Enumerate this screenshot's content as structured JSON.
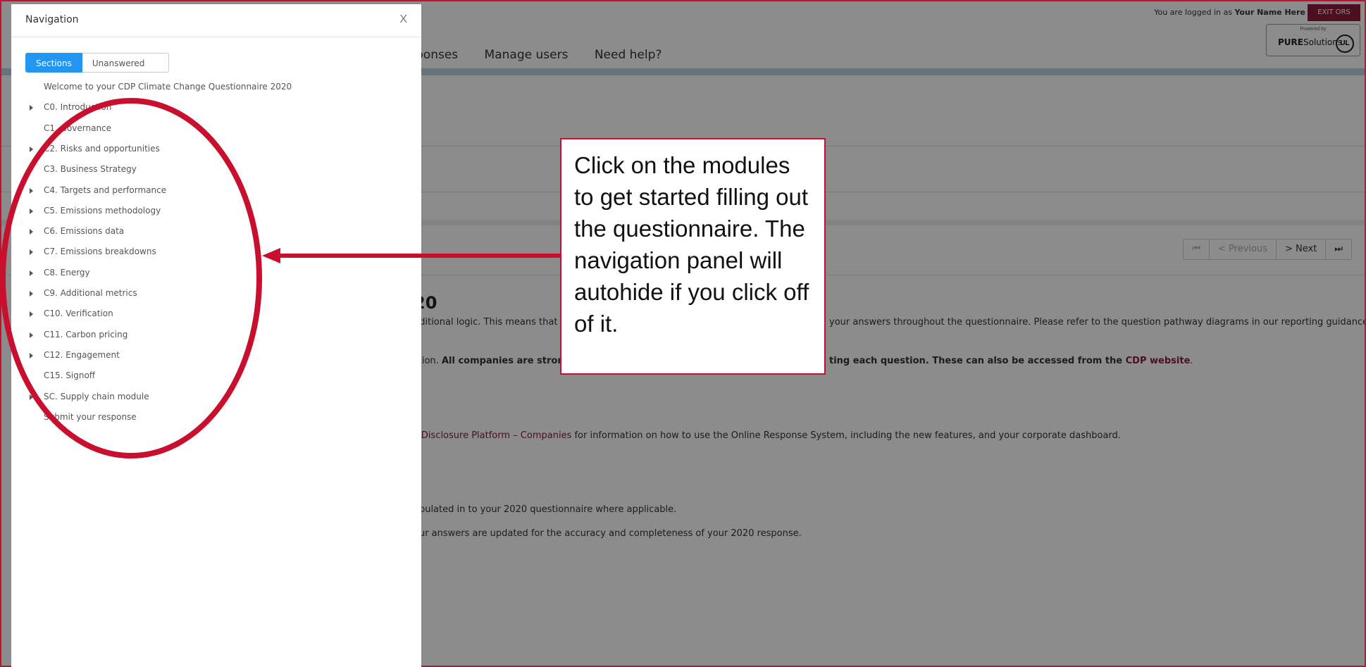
{
  "header": {
    "login_prefix": "You are logged in as ",
    "user_name": "Your Name Here",
    "exit_label": "EXIT ORS",
    "powered_by": "Powered by",
    "pure_bold": "PURE",
    "pure_rest": "Solutions",
    "ul_logo": "UL",
    "nav_items": [
      "ponses",
      "Manage users",
      "Need help?"
    ]
  },
  "pager": {
    "first_icon": "skip-first-icon",
    "prev_label": "< Previous",
    "next_label": "> Next",
    "last_icon": "skip-last-icon"
  },
  "main": {
    "heading": "20",
    "line1_a": "nditional logic. This means that t",
    "line1_b": "your answers throughout the questionnaire. Please refer to the question pathway diagrams in our reporting guidance",
    "line2_a": "stion. ",
    "line2_bold": "All companies are strong",
    "line2_b": "ting each question. These can also be accessed from the ",
    "line2_link": "CDP website",
    "line2_end": ".",
    "line3_link": "s Disclosure Platform – Companies",
    "line3_text": " for information on how to use the Online Response System, including the new features, and your corporate dashboard.",
    "line4": "opulated in to your 2020  questionnaire where applicable.",
    "line5": "our answers are updated for the accuracy and completeness of your 2020  response."
  },
  "panel": {
    "title": "Navigation",
    "close": "X",
    "tab_sections": "Sections",
    "tab_unanswered": "Unanswered",
    "items": [
      {
        "label": "Welcome to your CDP Climate Change Questionnaire 2020",
        "caret": false
      },
      {
        "label": "C0. Introduction",
        "caret": true
      },
      {
        "label": "C1. Governance",
        "caret": false
      },
      {
        "label": "C2. Risks and opportunities",
        "caret": true
      },
      {
        "label": "C3. Business Strategy",
        "caret": true
      },
      {
        "label": "C4. Targets and performance",
        "caret": true
      },
      {
        "label": "C5. Emissions methodology",
        "caret": true
      },
      {
        "label": "C6. Emissions data",
        "caret": true
      },
      {
        "label": "C7. Emissions breakdowns",
        "caret": true
      },
      {
        "label": "C8. Energy",
        "caret": true
      },
      {
        "label": "C9. Additional metrics",
        "caret": true
      },
      {
        "label": "C10. Verification",
        "caret": true
      },
      {
        "label": "C11. Carbon pricing",
        "caret": true
      },
      {
        "label": "C12. Engagement",
        "caret": true
      },
      {
        "label": "C15. Signoff",
        "caret": false
      },
      {
        "label": "SC. Supply chain module",
        "caret": true
      },
      {
        "label": "Submit your response",
        "caret": false
      }
    ]
  },
  "callout": {
    "text": "Click on the modules to get started filling out the questionnaire. The navigation panel will autohide if you click off of it."
  },
  "colors": {
    "annotation": "#c8102e",
    "brand": "#8a1c3a",
    "active_tab": "#2196f3"
  }
}
